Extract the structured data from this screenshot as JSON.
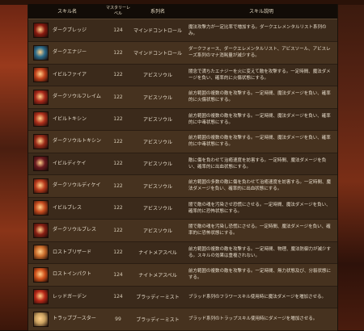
{
  "header": {
    "skill_name": "スキル名",
    "mastery_level": "マスタリーレベル",
    "tree_name": "系列名",
    "description": "スキル説明"
  },
  "rows": [
    {
      "icon": "dark-swirl-icon",
      "color": "#8a1a10",
      "name": "ダークブレッジ",
      "level": "124",
      "tree": "マインドコントロール",
      "desc": "魔法攻撃力が一定比率で増加する。ダークエレメンタルリスト系列のみ。"
    },
    {
      "icon": "dark-energy-icon",
      "color": "#2a6a8a",
      "name": "ダークエナジー",
      "level": "122",
      "tree": "マインドコントロール",
      "desc": "ダークフォース、ダークエレメンタルリスト、アビスソール、アビスレーズ系列のマナ消耗量が減少する。"
    },
    {
      "icon": "evil-fire-icon",
      "color": "#c0401a",
      "name": "イビルファイア",
      "level": "122",
      "tree": "アビスソウル",
      "desc": "闇念で満ちたエナジーを火に変えて敵を攻撃する。一定時間、魔法ダメージを負い、確率的に火傷状態にする。"
    },
    {
      "icon": "dark-soul-flame-icon",
      "color": "#a8281a",
      "name": "ダークソウルフレイム",
      "level": "122",
      "tree": "アビスソウル",
      "desc": "前方範囲の複数の敵を攻撃する。一定時間、魔法ダメージを負い、確率的に火傷状態にする。"
    },
    {
      "icon": "evil-toxin-icon",
      "color": "#b0301c",
      "name": "イビルトキシン",
      "level": "122",
      "tree": "アビスソウル",
      "desc": "前方範囲の複数の敵を攻撃する。一定時間、魔法ダメージを負い、確率的に中毒状態にする。"
    },
    {
      "icon": "dark-soul-toxin-icon",
      "color": "#9a2a18",
      "name": "ダークソウルトキシン",
      "level": "122",
      "tree": "アビスソウル",
      "desc": "前方範囲の複数の敵を攻撃する。一定時間、魔法ダメージを負い、確率的に中毒状態にする。"
    },
    {
      "icon": "evil-decay-icon",
      "color": "#6a1a20",
      "name": "イビルディケイ",
      "level": "122",
      "tree": "アビスソウル",
      "desc": "敵に傷を負わせて治癒速度を妨害する。一定時間、魔法ダメージを負い、確率的に出血状態にする。"
    },
    {
      "icon": "dark-soul-decay-icon",
      "color": "#b83a1c",
      "name": "ダークソウルディケイ",
      "level": "122",
      "tree": "アビスソウル",
      "desc": "前方範囲の多数の敵に傷を負わせて治癒速度を妨害する。一定時間、魔法ダメージを負い、確率的に出血状態にする。"
    },
    {
      "icon": "evil-bless-icon",
      "color": "#c44a1e",
      "name": "イビルブレス",
      "level": "122",
      "tree": "アビスソウル",
      "desc": "闇で敵の魂を汚染させ恐慌にさせる。一定時間、魔法ダメージを負い、確率的に恐怖状態にする。"
    },
    {
      "icon": "dark-soul-bless-icon",
      "color": "#8a2014",
      "name": "ダークソウルブレス",
      "level": "122",
      "tree": "アビスソウル",
      "desc": "闇で敵の魂を汚染し恐慌にさせる。一定時間、魔法ダメージを負い、確率的に恐怖状態にする。"
    },
    {
      "icon": "lost-blizzard-icon",
      "color": "#c86a2a",
      "name": "ロストブリザード",
      "level": "122",
      "tree": "ナイトメアスペル",
      "desc": "前方範囲の複数の敵を攻撃する。一定時間、物理、魔法防御力が減少する。スキルの効果は重複されない。"
    },
    {
      "icon": "lost-impact-icon",
      "color": "#d0501a",
      "name": "ロストインパクト",
      "level": "124",
      "tree": "ナイトメアスペル",
      "desc": "前方範囲の複数の敵を攻撃する。一定時間、無力状態及び、分裂状態にする。"
    },
    {
      "icon": "red-garden-icon",
      "color": "#b82818",
      "name": "レッドガーデン",
      "level": "124",
      "tree": "ブラッディーミスト",
      "desc": "ブラッド系列のフラワースキル使用時に魔法ダメージを増加させる。"
    },
    {
      "icon": "trap-booster-icon",
      "color": "#c8a060",
      "name": "トラップブースター",
      "level": "99",
      "tree": "ブラッディーミスト",
      "desc": "ブラッド系列のトラップスキル使用時にダメージを増加させる。"
    }
  ]
}
